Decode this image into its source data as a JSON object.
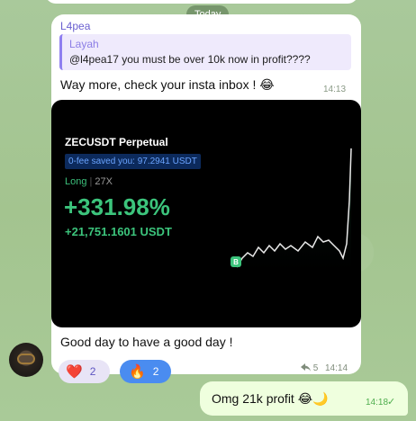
{
  "date_label": "Today",
  "message": {
    "sender": "L4pea",
    "reply": {
      "name": "Layah",
      "text": "@l4pea17 you must be over 10k now in profit????"
    },
    "text": "Way more, check your insta inbox !",
    "text_emoji": "😂",
    "time": "14:13",
    "card": {
      "title": "ZECUSDT Perpetual",
      "fee_badge": "0-fee saved you: 97.2941 USDT",
      "side": "Long",
      "leverage": "27X",
      "pnl_pct": "+331.98%",
      "pnl_usdt": "+21,751.1601 USDT",
      "marker": "B"
    },
    "caption": "Good day to have a good day !",
    "reactions": [
      {
        "icon": "❤️",
        "count": "2"
      },
      {
        "icon": "🔥",
        "count": "2"
      }
    ],
    "reply_count": "5",
    "time2": "14:14"
  },
  "outgoing": {
    "text": "Omg 21k profit",
    "emoji": "😂🌙",
    "time": "14:18",
    "check": "✓"
  },
  "colors": {
    "accent": "#6a5fd0",
    "profit": "#3cc47c",
    "outgoing_bg": "#efffde"
  }
}
